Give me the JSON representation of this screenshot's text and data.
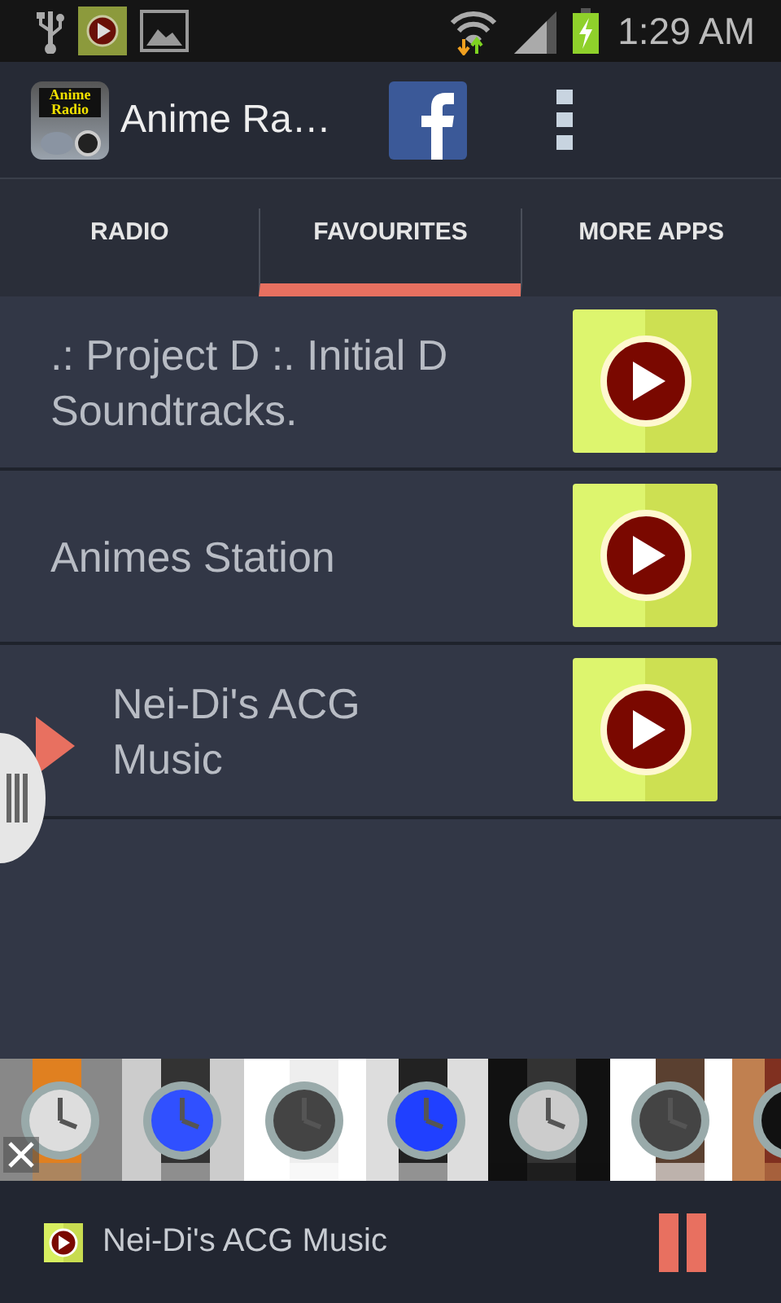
{
  "status_bar": {
    "time": "1:29 AM"
  },
  "app_bar": {
    "title": "Anime Ra…",
    "logo_text": "Anime Radio"
  },
  "tabs": [
    {
      "label": "RADIO",
      "selected": false
    },
    {
      "label": "FAVOURITES",
      "selected": true
    },
    {
      "label": "MORE APPS",
      "selected": false
    }
  ],
  "stations": [
    {
      "name": ".: Project D :. Initial D Soundtracks.",
      "playing": false
    },
    {
      "name": "Animes Station",
      "playing": false
    },
    {
      "name": "Nei-Di's ACG Music",
      "playing": true
    }
  ],
  "now_playing": {
    "title": "Nei-Di's ACG Music",
    "paused": false
  }
}
